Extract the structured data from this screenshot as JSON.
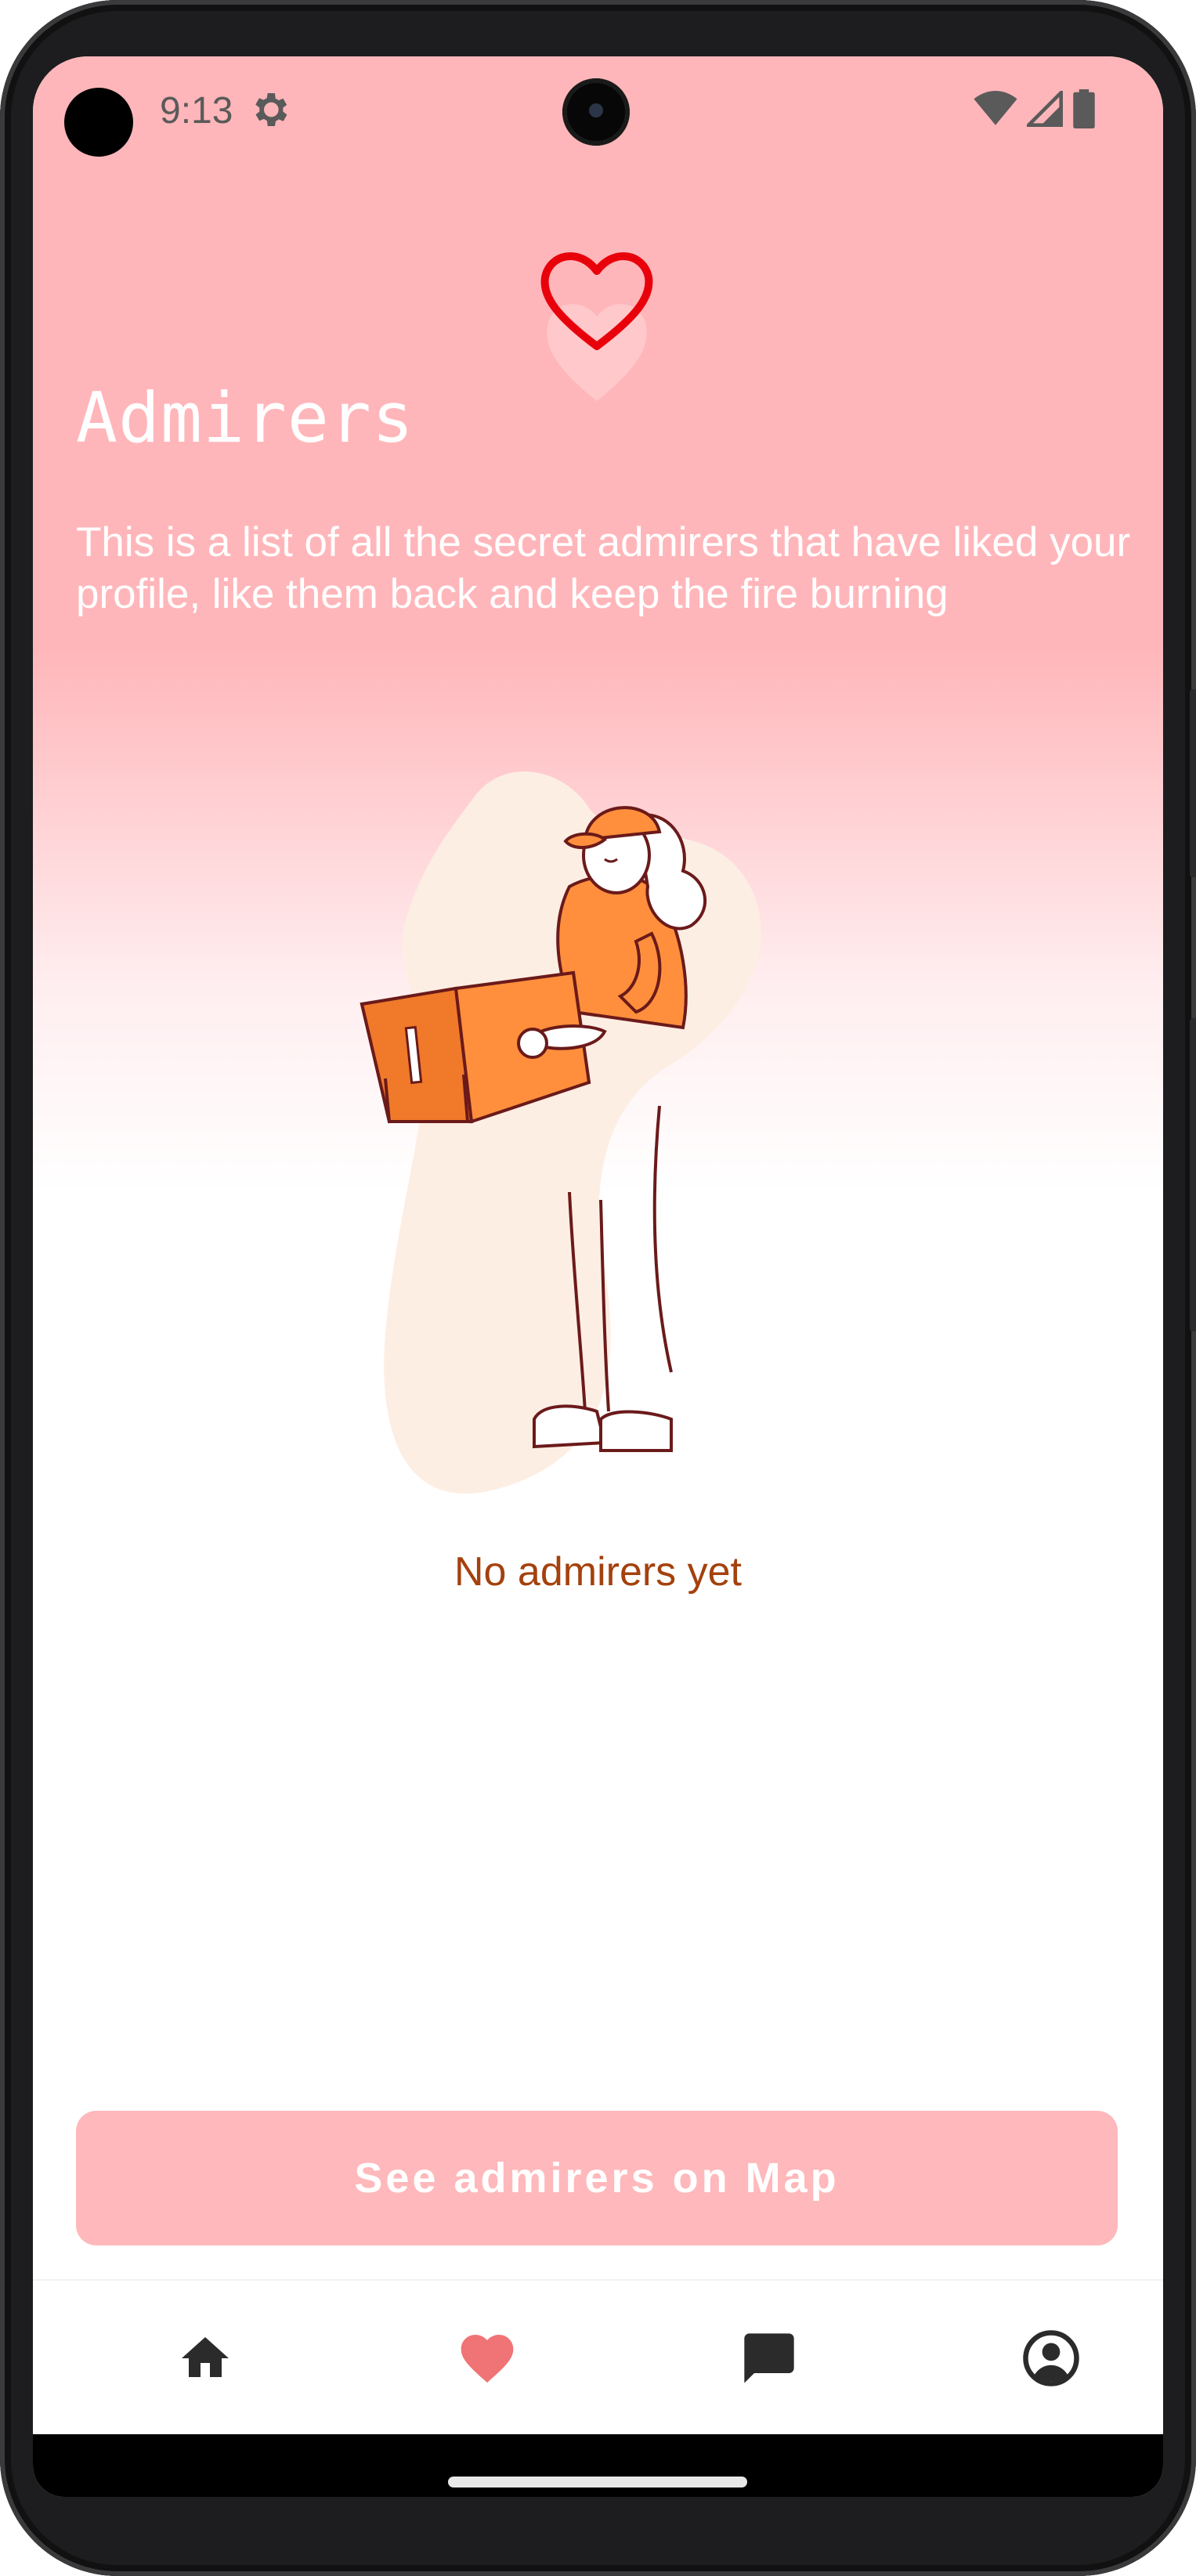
{
  "status_bar": {
    "time": "9:13",
    "icons": [
      "gear-icon",
      "wifi-icon",
      "signal-icon",
      "battery-icon"
    ]
  },
  "header": {
    "logo_icon": "heart-icon",
    "title": "Admirers",
    "subtitle": "This is a list of all the secret admirers that have liked your profile, like them back and keep the fire burning"
  },
  "empty_state": {
    "illustration": "person-holding-box-illustration",
    "message": "No admirers yet"
  },
  "actions": {
    "map_button_label": "See admirers on Map"
  },
  "bottom_nav": {
    "items": [
      {
        "name": "home",
        "icon": "home-icon",
        "active": false
      },
      {
        "name": "admirers",
        "icon": "heart-icon",
        "active": true
      },
      {
        "name": "chat",
        "icon": "chat-icon",
        "active": false
      },
      {
        "name": "profile",
        "icon": "account-icon",
        "active": false
      }
    ]
  },
  "colors": {
    "header_pink": "#ffb6ba",
    "accent_red": "#e8000b",
    "button_pink": "#ffb8bb",
    "nav_active": "#f07376",
    "nav_inactive": "#2b2b2b",
    "empty_text": "#a4410d",
    "illustration_orange": "#ff8f3c"
  }
}
